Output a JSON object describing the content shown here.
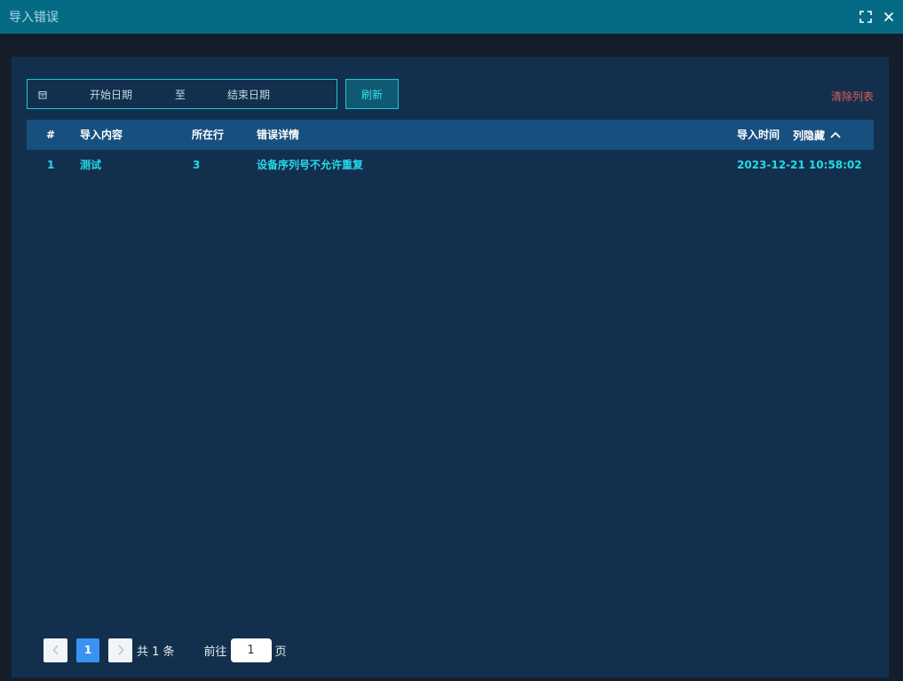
{
  "window": {
    "title": "导入错误",
    "maximize_icon": "fullscreen-icon",
    "close_icon": "close-icon"
  },
  "filters": {
    "start_date_placeholder": "开始日期",
    "separator": "至",
    "end_date_placeholder": "结束日期",
    "refresh_label": "刷新",
    "clear_label": "清除列表"
  },
  "colors": {
    "titlebar": "#056b85",
    "panel": "#12304d",
    "accent": "#1ec6d9",
    "table_header": "#17507f",
    "row_text": "#27d7ea",
    "danger": "#e85a5a",
    "page_active": "#3a93f0"
  },
  "table": {
    "headers": {
      "index": "#",
      "content": "导入内容",
      "line": "所在行",
      "detail": "错误详情",
      "time": "导入时间",
      "hide_columns": "列隐藏"
    },
    "rows": [
      {
        "index": "1",
        "content": "测试",
        "line": "3",
        "detail": "设备序列号不允许重复",
        "time": "2023-12-21 10:58:02"
      }
    ]
  },
  "pagination": {
    "current_page": "1",
    "total_text": "共 1 条",
    "goto_label": "前往",
    "goto_value": "1",
    "page_unit": "页"
  }
}
